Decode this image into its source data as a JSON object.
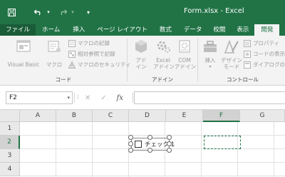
{
  "titlebar": {
    "title": "Form.xlsx - Excel",
    "qat_more": "▾"
  },
  "tabs": [
    {
      "label": "ファイル"
    },
    {
      "label": "ホーム"
    },
    {
      "label": "挿入"
    },
    {
      "label": "ページ レイアウト"
    },
    {
      "label": "数式"
    },
    {
      "label": "データ"
    },
    {
      "label": "校閲"
    },
    {
      "label": "表示"
    },
    {
      "label": "開発"
    }
  ],
  "ribbon": {
    "code": {
      "label": "コード",
      "visual_basic": "Visual Basic",
      "macro": "マクロ",
      "record_macro": "マクロの記録",
      "relative_ref": "相対参照で記録",
      "macro_security": "マクロのセキュリティ"
    },
    "addins": {
      "label": "アドイン",
      "addin_line1": "アド",
      "addin_line2": "イン",
      "excel_addin_line1": "Excel",
      "excel_addin_line2": "アドイン",
      "com_addin_line1": "COM",
      "com_addin_line2": "アドイン"
    },
    "controls": {
      "label": "コントロール",
      "insert": "挿入",
      "insert_arrow": "▾",
      "design_mode_line1": "デザイン",
      "design_mode_line2": "モード",
      "properties": "プロパティ",
      "view_code": "コードの表示",
      "run_dialog": "ダイアログの実"
    }
  },
  "formula_bar": {
    "name_box": "F2",
    "name_box_arrow": "▾",
    "more": "⁝",
    "cancel": "✕",
    "enter": "✓",
    "fx": "fx",
    "formula": ""
  },
  "grid": {
    "columns": [
      "A",
      "B",
      "C",
      "D",
      "E",
      "F",
      "G"
    ],
    "rows": [
      "1",
      "2",
      "3",
      "4"
    ],
    "selected_column": "F",
    "selected_row": "2"
  },
  "checkbox_control": {
    "label": "チェック 1"
  },
  "colors": {
    "accent": "#217346",
    "ribbon_bg": "#f3f3f3"
  }
}
